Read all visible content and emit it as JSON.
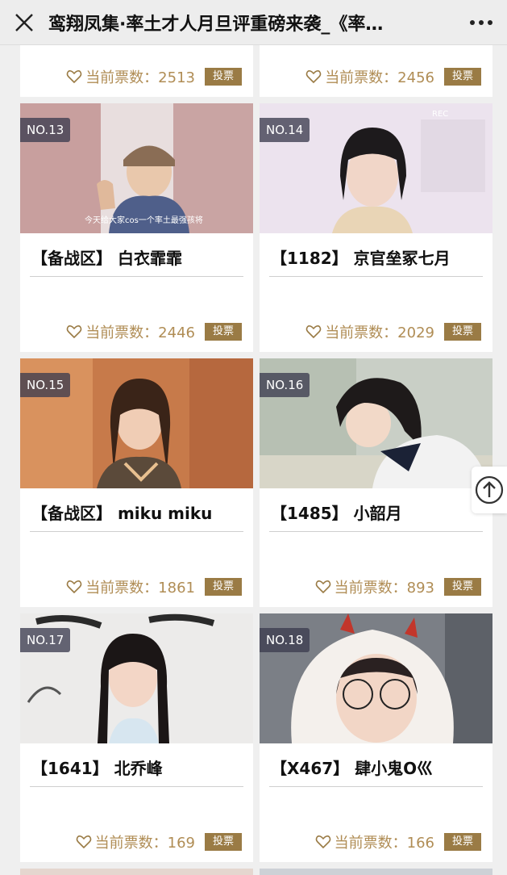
{
  "header": {
    "title": "鸾翔凤集·率土才人月旦评重磅来袭_《率…"
  },
  "colors": {
    "accent": "#9a7b45",
    "vote_text": "#b08d55",
    "badge_bg": "#3c3c50"
  },
  "vote_button_label": "投票",
  "vote_prefix": "当前票数：",
  "top_partial_cards": [
    {
      "votes_text": "当前票数：2513",
      "button": "投票"
    },
    {
      "votes_text": "当前票数：2456",
      "button": "投票"
    }
  ],
  "cards": [
    {
      "no": "NO.13",
      "name": "【备战区】 白衣霏霏",
      "votes_text": "当前票数：2446",
      "button": "投票",
      "caption": "今天给大家cos一个率土最强孩将"
    },
    {
      "no": "NO.14",
      "name": "【1182】 京官垒冢七月",
      "votes_text": "当前票数：2029",
      "button": "投票",
      "caption": "REC"
    },
    {
      "no": "NO.15",
      "name": "【备战区】 miku miku",
      "votes_text": "当前票数：1861",
      "button": "投票"
    },
    {
      "no": "NO.16",
      "name": "【1485】 小韶月",
      "votes_text": "当前票数：893",
      "button": "投票"
    },
    {
      "no": "NO.17",
      "name": "【1641】 北乔峰",
      "votes_text": "当前票数：169",
      "button": "投票"
    },
    {
      "no": "NO.18",
      "name": "【X467】 肆小鬼O巛",
      "votes_text": "当前票数：166",
      "button": "投票"
    }
  ],
  "icons": {
    "close": "close-icon",
    "more": "more-dots-icon",
    "heart": "heart-icon",
    "scroll_top": "arrow-up-circle-icon"
  }
}
